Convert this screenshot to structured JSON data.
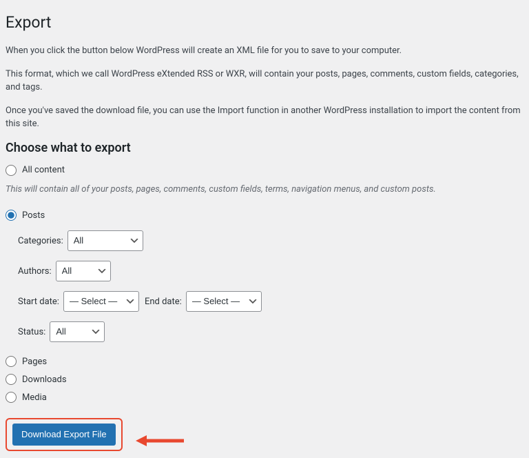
{
  "header": {
    "title": "Export"
  },
  "intro": {
    "p1": "When you click the button below WordPress will create an XML file for you to save to your computer.",
    "p2": "This format, which we call WordPress eXtended RSS or WXR, will contain your posts, pages, comments, custom fields, categories, and tags.",
    "p3": "Once you've saved the download file, you can use the Import function in another WordPress installation to import the content from this site."
  },
  "choose": {
    "heading": "Choose what to export",
    "options": {
      "all": "All content",
      "all_desc": "This will contain all of your posts, pages, comments, custom fields, terms, navigation menus, and custom posts.",
      "posts": "Posts",
      "pages": "Pages",
      "downloads": "Downloads",
      "media": "Media"
    }
  },
  "filters": {
    "categories_label": "Categories:",
    "categories_value": "All",
    "authors_label": "Authors:",
    "authors_value": "All",
    "start_date_label": "Start date:",
    "start_date_value": "— Select —",
    "end_date_label": "End date:",
    "end_date_value": "— Select —",
    "status_label": "Status:",
    "status_value": "All"
  },
  "submit": {
    "button": "Download Export File"
  }
}
